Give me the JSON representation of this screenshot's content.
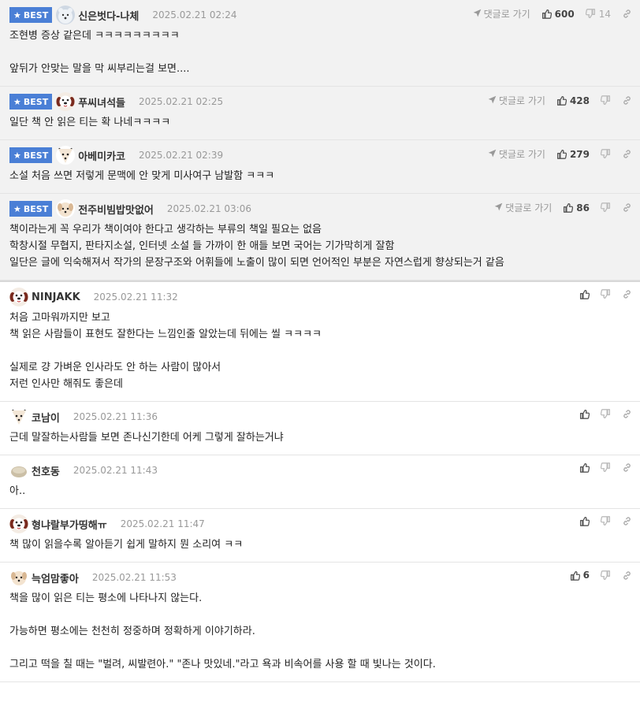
{
  "ui": {
    "best_label": "BEST",
    "reply_label": "댓글로 가기"
  },
  "colors": {
    "best_badge": "#4a7fd6",
    "best_background": "#f2f2f2"
  },
  "best_comments": [
    {
      "nickname": "신은벗다-나체",
      "time": "2025.02.21 02:24",
      "likes": "600",
      "dislikes": "14",
      "avatar": "white-bear-avatar",
      "lines": [
        "조현병 증상 같은데 ㅋㅋㅋㅋㅋㅋㅋㅋㅋ",
        "",
        "앞뒤가 안맞는 말을 막 씨부리는걸 보면...."
      ]
    },
    {
      "nickname": "푸씨녀석들",
      "time": "2025.02.21 02:25",
      "likes": "428",
      "avatar": "dog-face-avatar",
      "lines": [
        "일단 책 안 읽은 티는 확 나네ㅋㅋㅋㅋ"
      ]
    },
    {
      "nickname": "아베미카코",
      "time": "2025.02.21 02:39",
      "likes": "279",
      "avatar": "fox-face-avatar",
      "lines": [
        "소설 처음 쓰면 저렇게 문맥에 안 맞게 미사여구 남발함 ㅋㅋㅋ"
      ]
    },
    {
      "nickname": "전주비빔밥맛없어",
      "time": "2025.02.21 03:06",
      "likes": "86",
      "avatar": "puppy-avatar",
      "lines": [
        "책이라는게 꼭 우리가 책이여야 한다고 생각하는 부류의 책일 필요는 없음",
        "학창시절 무협지, 판타지소설, 인터넷 소설 들 가까이 한 애들 보면 국어는 기가막히게 잘함",
        "일단은 글에 익숙해져서 작가의 문장구조와 어휘들에 노출이 많이 되면 언어적인 부분은 자연스럽게 향상되는거 같음"
      ]
    }
  ],
  "comments": [
    {
      "nickname": "NINJAKK",
      "time": "2025.02.21 11:32",
      "avatar": "dog-face-avatar",
      "lines": [
        "처음 고마워까지만 보고",
        "책 읽은 사람들이 표현도 잘한다는 느낌인줄 알았는데 뒤에는 씰 ㅋㅋㅋㅋ",
        "",
        "실제로 걍 가벼운 인사라도 안 하는 사람이 많아서",
        "저런 인사만 해줘도 좋은데"
      ]
    },
    {
      "nickname": "코남이",
      "time": "2025.02.21 11:36",
      "avatar": "fox-face-avatar",
      "lines": [
        "근데 말잘하는사람들 보면 존나신기한데 어케 그렇게 잘하는거냐"
      ]
    },
    {
      "nickname": "천호동",
      "time": "2025.02.21 11:43",
      "avatar": "bread-avatar",
      "lines": [
        "아.."
      ]
    },
    {
      "nickname": "형냐랄부가띵해ㅠ",
      "time": "2025.02.21 11:47",
      "avatar": "dog-face-avatar",
      "lines": [
        "책 많이 읽을수록 알아듣기 쉽게 말하지 뭔 소리여 ㅋㅋ"
      ]
    },
    {
      "nickname": "늑엄맘좋아",
      "time": "2025.02.21 11:53",
      "likes": "6",
      "avatar": "puppy-avatar",
      "lines": [
        "책을 많이 읽은 티는 평소에 나타나지 않는다.",
        "",
        "가능하면 평소에는 천천히 정중하며 정확하게 이야기하라.",
        "",
        "그리고 떡을 칠 때는 \"벌려, 씨발련아.\" \"존나 맛있네.\"라고 욕과 비속어를 사용 할 때 빛나는 것이다."
      ]
    }
  ]
}
